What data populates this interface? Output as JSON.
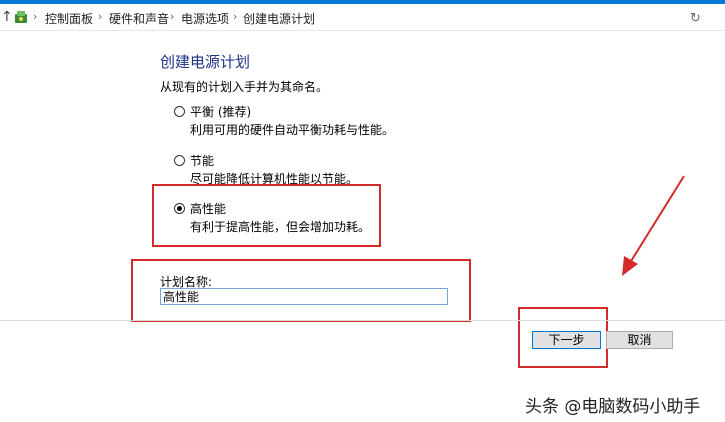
{
  "breadcrumb": {
    "items": [
      "控制面板",
      "硬件和声音",
      "电源选项",
      "创建电源计划"
    ]
  },
  "page": {
    "title": "创建电源计划",
    "subtitle": "从现有的计划入手并为其命名。"
  },
  "options": [
    {
      "label": "平衡 (推荐)",
      "desc": "利用可用的硬件自动平衡功耗与性能。",
      "checked": false
    },
    {
      "label": "节能",
      "desc": "尽可能降低计算机性能以节能。",
      "checked": false
    },
    {
      "label": "高性能",
      "desc": "有利于提高性能，但会增加功耗。",
      "checked": true
    }
  ],
  "plan_name": {
    "label": "计划名称:",
    "value": "高性能"
  },
  "buttons": {
    "next": "下一步",
    "cancel": "取消"
  },
  "icons": {
    "up": "up-arrow-icon",
    "control_panel": "control-panel-icon",
    "refresh": "refresh-icon"
  },
  "colors": {
    "accent": "#0078d7",
    "title": "#1e3287",
    "highlight": "#d42a2a"
  },
  "watermark": "头条 @电脑数码小助手"
}
